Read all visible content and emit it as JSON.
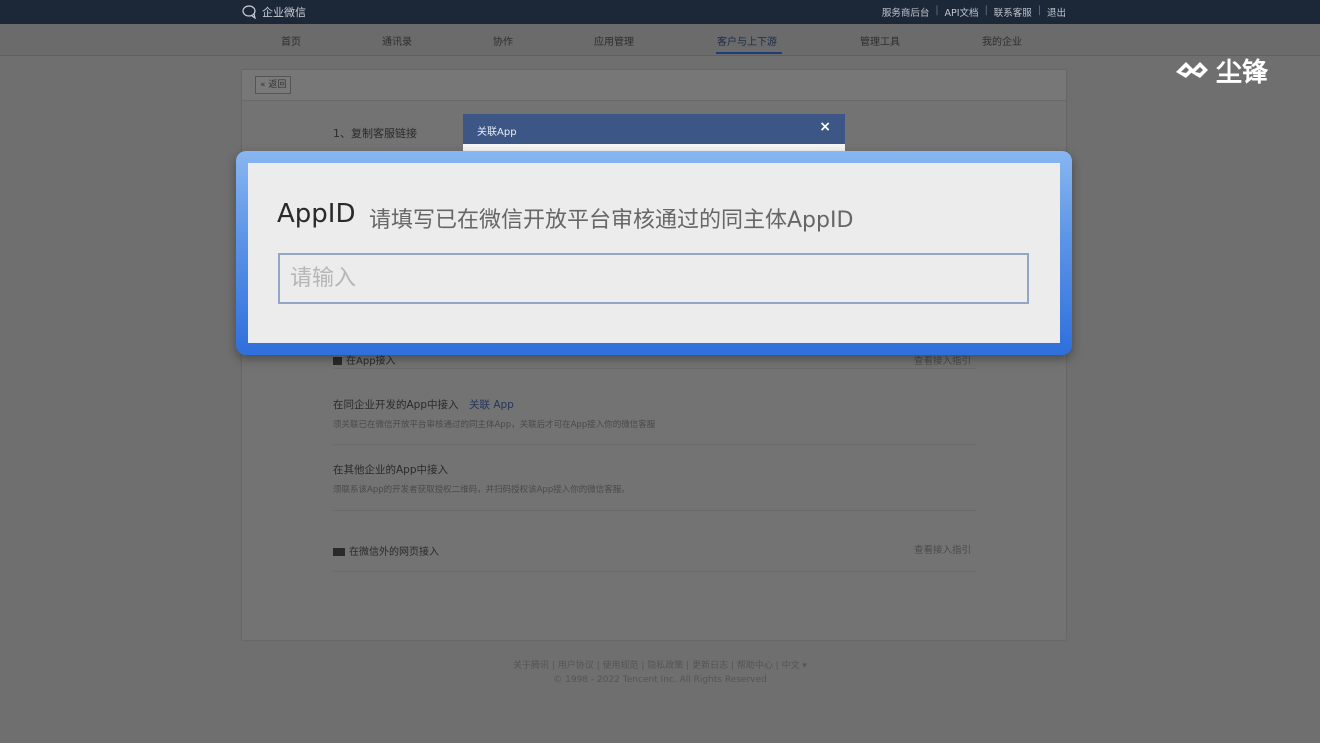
{
  "topbar": {
    "brand": "企业微信",
    "links": [
      "服务商后台",
      "API文档",
      "联系客服",
      "退出"
    ]
  },
  "nav": {
    "items": [
      "首页",
      "通讯录",
      "协作",
      "应用管理",
      "客户与上下游",
      "管理工具",
      "我的企业"
    ],
    "active_index": 4
  },
  "page": {
    "back_label": "« 返回",
    "step1": "1、复制客服链接"
  },
  "dialog": {
    "title": "关联App",
    "close_symbol": "×"
  },
  "zoom_panel": {
    "label": "AppID",
    "hint": "请填写已在微信开放平台审核通过的同主体AppID",
    "placeholder": "请输入"
  },
  "sections": {
    "app": {
      "title": "在App接入",
      "guide": "查看接入指引",
      "items": [
        {
          "title": "在同企业开发的App中接入",
          "action": "关联 App",
          "desc": "须关联已在微信开放平台审核通过的同主体App，关联后才可在App接入你的微信客服"
        },
        {
          "title": "在其他企业的App中接入",
          "action": "",
          "desc": "须联系该App的开发者获取授权二维码，并扫码授权该App接入你的微信客服。"
        }
      ]
    },
    "web": {
      "title": "在微信外的网页接入",
      "guide": "查看接入指引"
    }
  },
  "footer": {
    "links": "关于腾讯 | 用户协议 | 使用规范 | 隐私政策 | 更新日志 | 帮助中心 | 中文 ▾",
    "copyright": "© 1998 - 2022 Tencent Inc. All Rights Reserved"
  },
  "watermark": {
    "text": "尘锋"
  }
}
